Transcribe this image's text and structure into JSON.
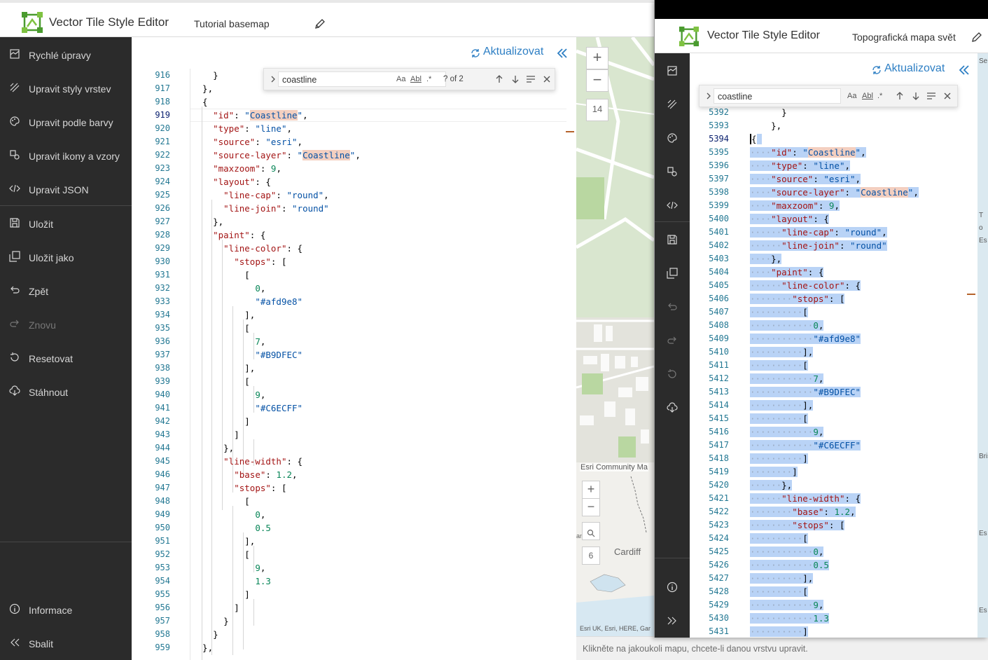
{
  "window_left": {
    "app_title": "Vector Tile Style Editor",
    "map_name": "Tutorial basemap",
    "sidebar": [
      {
        "label": "Rychlé úpravy",
        "icon": "quick-edit-icon"
      },
      {
        "label": "Upravit styly vrstev",
        "icon": "layer-style-icon"
      },
      {
        "label": "Upravit podle barvy",
        "icon": "palette-icon"
      },
      {
        "label": "Upravit ikony a vzory",
        "icon": "icons-patterns-icon"
      },
      {
        "label": "Upravit JSON",
        "icon": "code-icon"
      },
      {
        "label": "Uložit",
        "icon": "save-icon"
      },
      {
        "label": "Uložit jako",
        "icon": "save-as-icon"
      },
      {
        "label": "Zpět",
        "icon": "undo-icon"
      },
      {
        "label": "Znovu",
        "icon": "redo-icon"
      },
      {
        "label": "Resetovat",
        "icon": "reset-icon"
      },
      {
        "label": "Stáhnout",
        "icon": "download-icon"
      },
      {
        "label": "Informace",
        "icon": "info-icon"
      },
      {
        "label": "Sbalit",
        "icon": "collapse-icon"
      }
    ],
    "update_label": "Aktualizovat",
    "find": {
      "value": "coastline",
      "match_case": "Aa",
      "whole_word": "Abl",
      "regex": ".*",
      "count": "? of 2"
    },
    "first_line": 916,
    "current_line": 919,
    "code_lines": [
      "    }",
      "  },",
      "  {",
      "    \"id\": \"Coastline\",",
      "    \"type\": \"line\",",
      "    \"source\": \"esri\",",
      "    \"source-layer\": \"Coastline\",",
      "    \"maxzoom\": 9,",
      "    \"layout\": {",
      "      \"line-cap\": \"round\",",
      "      \"line-join\": \"round\"",
      "    },",
      "    \"paint\": {",
      "      \"line-color\": {",
      "        \"stops\": [",
      "          [",
      "            0,",
      "            \"#afd9e8\"",
      "          ],",
      "          [",
      "            7,",
      "            \"#B9DFEC\"",
      "          ],",
      "          [",
      "            9,",
      "            \"#C6ECFF\"",
      "          ]",
      "        ]",
      "      },",
      "      \"line-width\": {",
      "        \"base\": 1.2,",
      "        \"stops\": [",
      "          [",
      "            0,",
      "            0.5",
      "          ],",
      "          [",
      "            9,",
      "            1.3",
      "          ]",
      "        ]",
      "      }",
      "    }",
      "  },"
    ],
    "map_zoom_level": "14",
    "inset_attribution": "Esri Community Ma",
    "inset_city": "Cardiff",
    "inset_zoom_level": "6",
    "inset_footer": "Esri UK, Esri, HERE, Gar",
    "inset_edge_label": "an"
  },
  "window_right": {
    "app_title": "Vector Tile Style Editor",
    "map_name": "Topografická mapa svět",
    "update_label": "Aktualizovat",
    "find": {
      "value": "coastline",
      "match_case": "Aa",
      "whole_word": "Abl",
      "regex": ".*"
    },
    "first_line": 5392,
    "current_line": 5394,
    "map_edge_labels": [
      "Se",
      "T",
      "o",
      "Es",
      "Bris",
      "Es",
      "Es"
    ]
  },
  "status_text": "Klikněte na jakoukoli mapu, chcete-li danou vrstvu upravit."
}
